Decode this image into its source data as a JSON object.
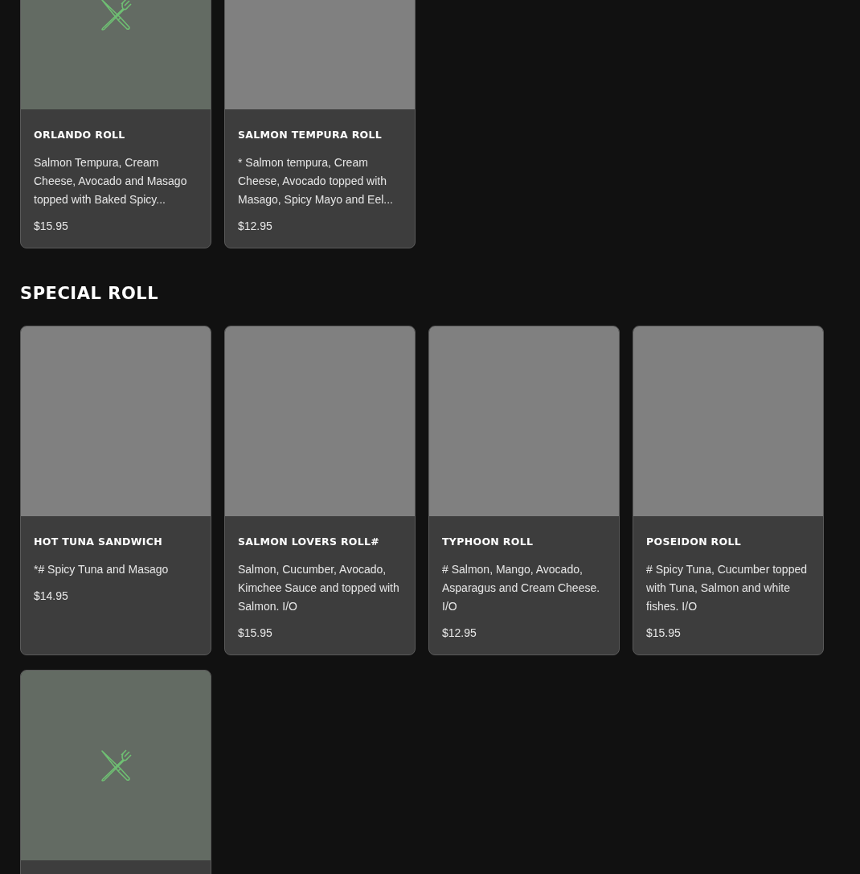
{
  "sections": [
    {
      "items": [
        {
          "name": "ORLANDO ROLL",
          "description": "Salmon Tempura, Cream Cheese, Avocado and Masago topped with Baked Spicy...",
          "price": "$15.95",
          "image": {
            "kind": "placeholder"
          }
        },
        {
          "name": "SALMON TEMPURA ROLL",
          "description": "* Salmon tempura, Cream Cheese, Avocado topped with Masago, Spicy Mayo and Eel...",
          "price": "$12.95",
          "image": {
            "kind": "blank"
          }
        }
      ]
    },
    {
      "title": "SPECIAL ROLL",
      "items": [
        {
          "name": "HOT TUNA SANDWICH",
          "description": "*# Spicy Tuna and Masago",
          "price": "$14.95",
          "image": {
            "kind": "blank"
          }
        },
        {
          "name": "SALMON LOVERS ROLL#",
          "description": "Salmon, Cucumber, Avocado, Kimchee Sauce and topped with Salmon. I/O",
          "price": "$15.95",
          "image": {
            "kind": "blank"
          }
        },
        {
          "name": "TYPHOON ROLL",
          "description": "# Salmon, Mango, Avocado, Asparagus and Cream Cheese. I/O",
          "price": "$12.95",
          "image": {
            "kind": "blank"
          }
        },
        {
          "name": "POSEIDON ROLL",
          "description": "# Spicy Tuna, Cucumber topped with Tuna, Salmon and white fishes. I/O",
          "price": "$15.95",
          "image": {
            "kind": "blank"
          }
        },
        {
          "image": {
            "kind": "placeholder"
          }
        }
      ]
    }
  ]
}
